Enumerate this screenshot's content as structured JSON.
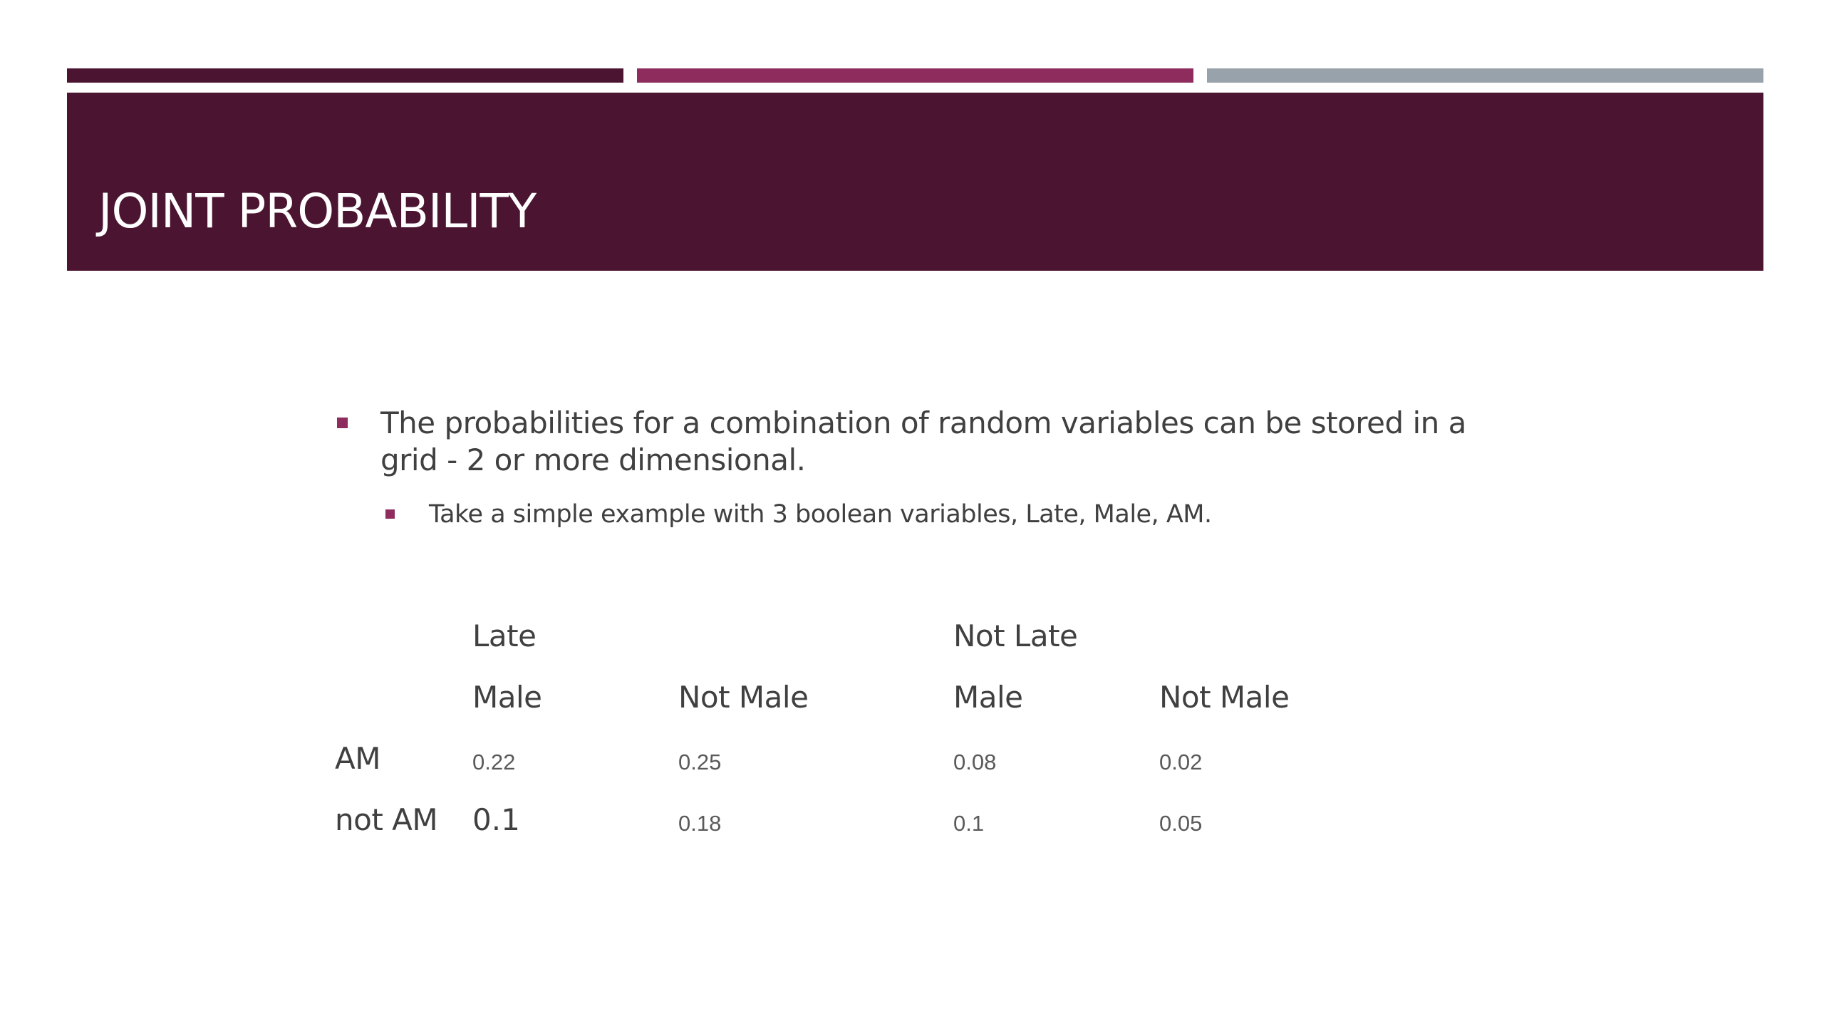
{
  "colors": {
    "plum_dark": "#4b1532",
    "magenta": "#8e2c5e",
    "gray": "#97a2aa",
    "bullet": "#8e2c5e",
    "text": "#404040"
  },
  "slide": {
    "title": "JOINT PROBABILITY",
    "bullets": [
      {
        "level": 1,
        "text": "The probabilities for a combination of random variables can be stored in a grid - 2 or more dimensional."
      },
      {
        "level": 2,
        "text": "Take a simple example with 3 boolean variables, Late, Male, AM."
      }
    ],
    "table": {
      "group_headers": [
        "Late",
        "Not Late"
      ],
      "column_headers": [
        "Male",
        "Not Male",
        "Male",
        "Not Male"
      ],
      "rows": [
        {
          "label": "AM",
          "values": [
            "0.22",
            "0.25",
            "0.08",
            "0.02"
          ]
        },
        {
          "label": "not AM",
          "values": [
            "0.1",
            "0.18",
            "0.1",
            "0.05"
          ]
        }
      ]
    }
  }
}
